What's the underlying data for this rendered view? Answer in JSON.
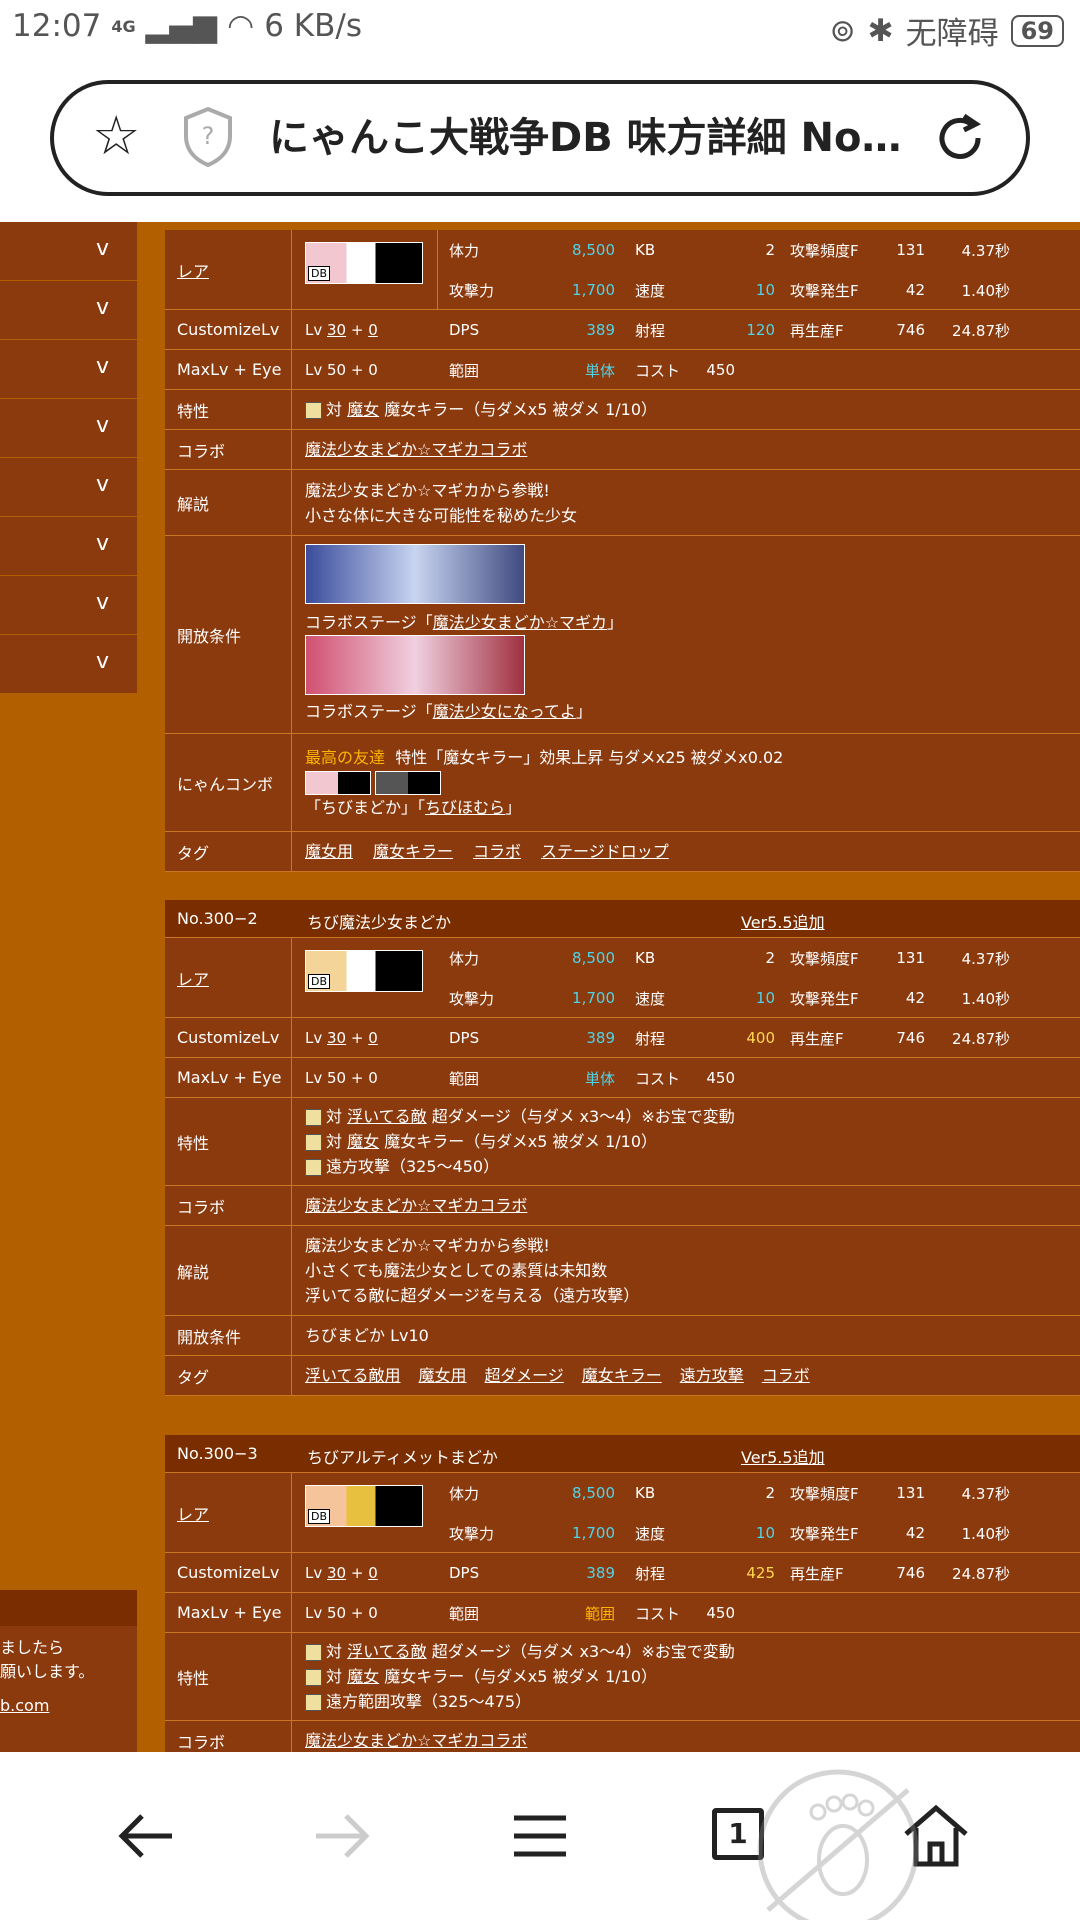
{
  "status": {
    "time": "12:07",
    "network": "4G",
    "speed": "6 KB/s",
    "a11y": "无障碍",
    "battery": "69"
  },
  "browser": {
    "title": "にゃんこ大戦争DB 味方詳細 No…",
    "icons": [
      "star-icon",
      "shield-icon",
      "reload-icon"
    ]
  },
  "sidebar": {
    "chevrons": [
      "v",
      "v",
      "v",
      "v",
      "v",
      "v",
      "v",
      "v"
    ],
    "footer_lines": [
      "ましたら",
      "願いします。",
      "b.com"
    ]
  },
  "common": {
    "l_tairyoku": "体力",
    "l_kougeki": "攻撃力",
    "l_dps": "DPS",
    "l_hani": "範囲",
    "l_kb": "KB",
    "l_sokudo": "速度",
    "l_shatei": "射程",
    "l_cost": "コスト",
    "l_hindo": "攻撃頻度F",
    "l_hassei": "攻撃発生F",
    "l_saisei": "再生産F",
    "lbl_rare": "レア",
    "lbl_customize": "CustomizeLv",
    "lbl_maxlv": "MaxLv + Eye",
    "lbl_tokusei": "特性",
    "lbl_colab": "コラボ",
    "lbl_kaisetsu": "解説",
    "lbl_kaiho": "開放条件",
    "lbl_combo": "にゃんコンボ",
    "lbl_tag": "タグ",
    "lv": "Lv",
    "lv30": "30",
    "plus": "+",
    "lv0": "0",
    "maxlv": "Lv 50 + 0",
    "hp": "8,500",
    "atk": "1,700",
    "dps": "389",
    "kb": "2",
    "spd": "10",
    "cost": "450",
    "freq": "131",
    "freq_s": "4.37秒",
    "occ": "42",
    "occ_s": "1.40秒",
    "reg": "746",
    "reg_s": "24.87秒",
    "thumb_tag": "DB"
  },
  "unit1": {
    "shatei": "120",
    "hani": "単体",
    "tokusei1_pre": "対",
    "tokusei1_target": "魔女",
    "tokusei1_text": "魔女キラー（与ダメx5 被ダメ 1/10）",
    "colab": "魔法少女まどか☆マギカコラボ",
    "desc1": "魔法少女まどか☆マギカから参戦!",
    "desc2": "小さな体に大きな可能性を秘めた少女",
    "kaiho1_pre": "コラボステージ「",
    "kaiho1_link": "魔法少女まどか☆マギカ",
    "kaiho1_post": "」",
    "kaiho2_pre": "コラボステージ「",
    "kaiho2_link": "魔法少女になってよ",
    "kaiho2_post": "」",
    "combo_name": "最高の友達",
    "combo_effect": "特性「魔女キラー」効果上昇 与ダメx25 被ダメx0.02",
    "combo_m1_pre": "「",
    "combo_m1": "ちびまどか",
    "combo_mid": "」「",
    "combo_m2": "ちびほむら",
    "combo_m2_post": "」",
    "tags": [
      "魔女用",
      "魔女キラー",
      "コラボ",
      "ステージドロップ"
    ]
  },
  "unit2": {
    "no": "No.300−2",
    "name": "ちび魔法少女まどか",
    "ver": "Ver5.5追加",
    "shatei": "400",
    "hani": "単体",
    "t1_pre": "対",
    "t1_target": "浮いてる敵",
    "t1_text": "超ダメージ（与ダメ x3～4）※お宝で変動",
    "t2_pre": "対",
    "t2_target": "魔女",
    "t2_text": "魔女キラー（与ダメx5 被ダメ 1/10）",
    "t3_text": "遠方攻撃（325～450）",
    "colab": "魔法少女まどか☆マギカコラボ",
    "desc1": "魔法少女まどか☆マギカから参戦!",
    "desc2": "小さくても魔法少女としての素質は未知数",
    "desc3": "浮いてる敵に超ダメージを与える（遠方攻撃）",
    "kaiho": "ちびまどか Lv10",
    "tags": [
      "浮いてる敵用",
      "魔女用",
      "超ダメージ",
      "魔女キラー",
      "遠方攻撃",
      "コラボ"
    ]
  },
  "unit3": {
    "no": "No.300−3",
    "name": "ちびアルティメットまどか",
    "ver": "Ver5.5追加",
    "shatei": "425",
    "hani": "範囲",
    "t1_pre": "対",
    "t1_target": "浮いてる敵",
    "t1_text": "超ダメージ（与ダメ x3～4）※お宝で変動",
    "t2_pre": "対",
    "t2_target": "魔女",
    "t2_text": "魔女キラー（与ダメx5 被ダメ 1/10）",
    "t3_text": "遠方範囲攻撃（325～475）",
    "colab_partial": "魔法少女まどか☆マギカコラボ",
    "lbl_partial": "コラボ"
  },
  "nav": {
    "icons": [
      "back-icon",
      "forward-icon",
      "menu-icon",
      "tabs-icon",
      "home-icon"
    ],
    "tab_count": "1"
  }
}
